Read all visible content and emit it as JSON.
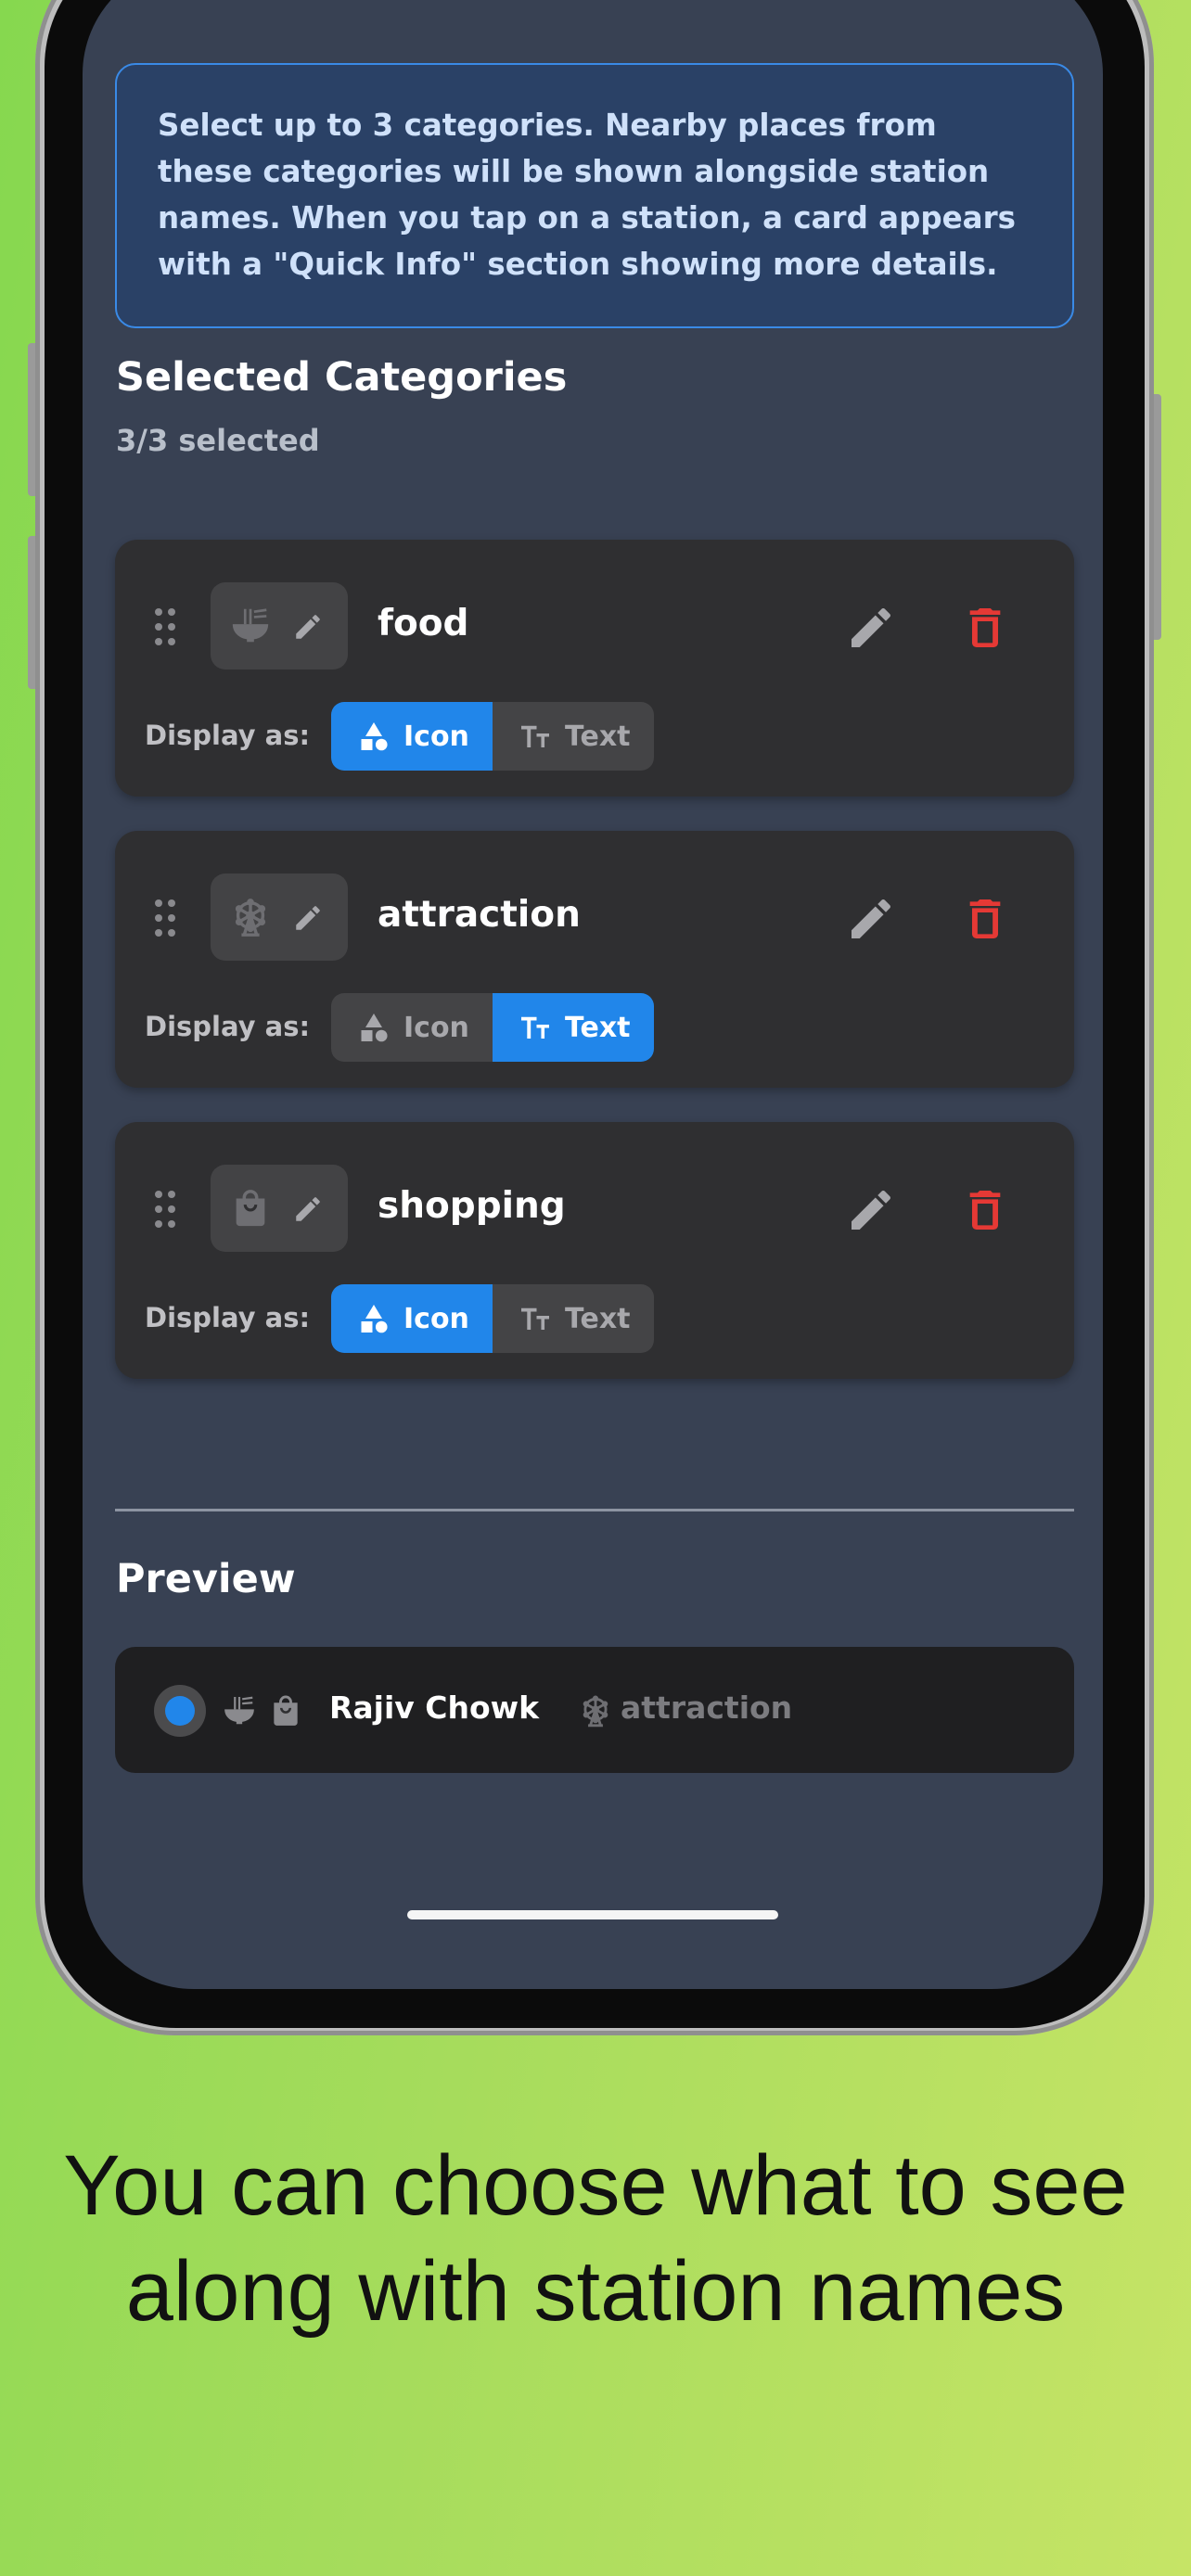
{
  "info": {
    "text": "Select up to 3 categories. Nearby places from these categories will be shown alongside station names. When you tap on a station, a card appears with a \"Quick Info\" section showing more details."
  },
  "selected": {
    "title": "Selected Categories",
    "count_text": "3/3 selected"
  },
  "categories": [
    {
      "name": "food",
      "icon": "noodle-bowl-icon",
      "display_label": "Display as:",
      "icon_option": "Icon",
      "text_option": "Text",
      "display_mode": "icon"
    },
    {
      "name": "attraction",
      "icon": "ferris-wheel-icon",
      "display_label": "Display as:",
      "icon_option": "Icon",
      "text_option": "Text",
      "display_mode": "text"
    },
    {
      "name": "shopping",
      "icon": "shopping-bag-icon",
      "display_label": "Display as:",
      "icon_option": "Icon",
      "text_option": "Text",
      "display_mode": "icon"
    }
  ],
  "preview": {
    "title": "Preview",
    "station_name": "Rajiv Chowk",
    "attraction_label": "attraction"
  },
  "caption": "You can choose what to see along with station names",
  "colors": {
    "accent": "#2186ea",
    "delete": "#e53935",
    "screen_bg": "#384153",
    "card_bg": "#2f2f31"
  }
}
